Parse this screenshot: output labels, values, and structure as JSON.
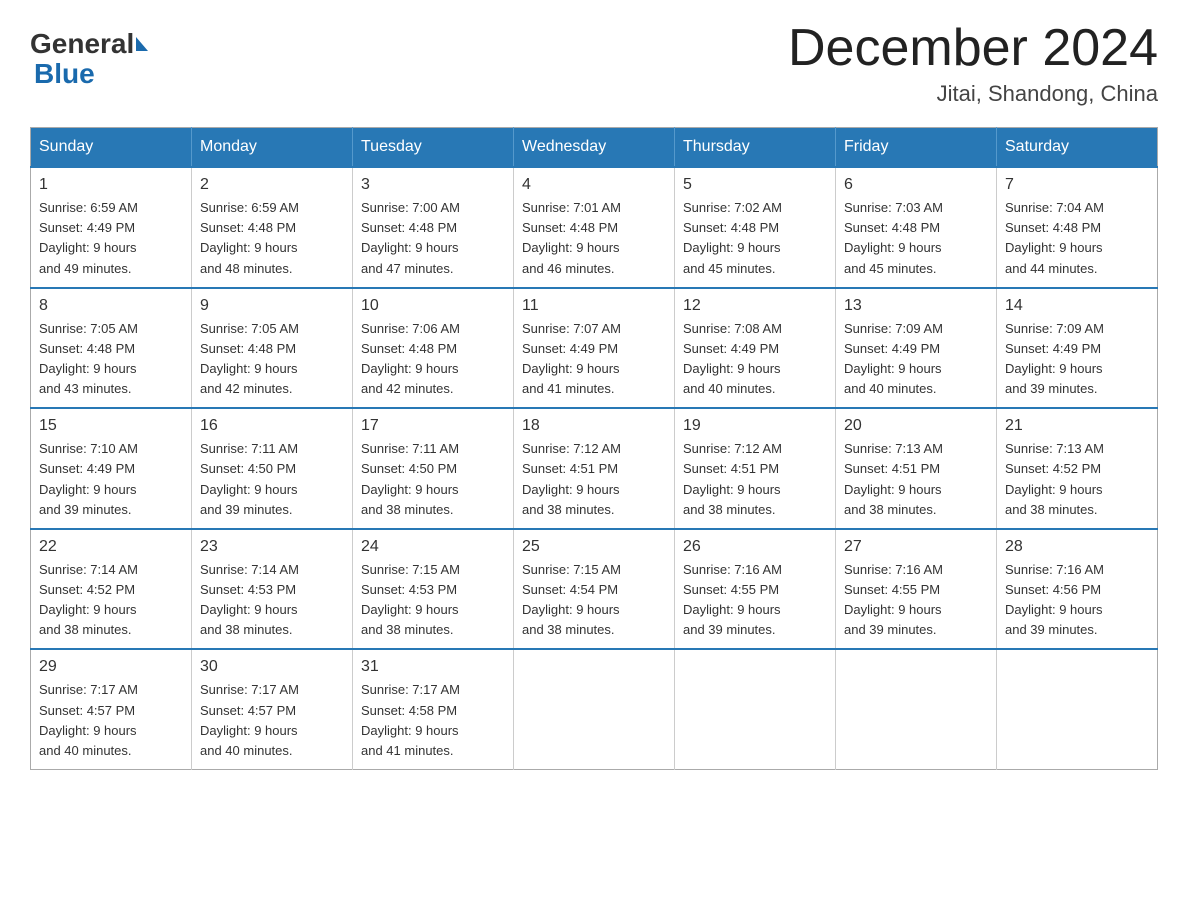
{
  "header": {
    "logo": {
      "general": "General",
      "blue": "Blue"
    },
    "title": "December 2024",
    "location": "Jitai, Shandong, China"
  },
  "days_of_week": [
    "Sunday",
    "Monday",
    "Tuesday",
    "Wednesday",
    "Thursday",
    "Friday",
    "Saturday"
  ],
  "weeks": [
    [
      {
        "day": "1",
        "sunrise": "6:59 AM",
        "sunset": "4:49 PM",
        "daylight": "9 hours and 49 minutes."
      },
      {
        "day": "2",
        "sunrise": "6:59 AM",
        "sunset": "4:48 PM",
        "daylight": "9 hours and 48 minutes."
      },
      {
        "day": "3",
        "sunrise": "7:00 AM",
        "sunset": "4:48 PM",
        "daylight": "9 hours and 47 minutes."
      },
      {
        "day": "4",
        "sunrise": "7:01 AM",
        "sunset": "4:48 PM",
        "daylight": "9 hours and 46 minutes."
      },
      {
        "day": "5",
        "sunrise": "7:02 AM",
        "sunset": "4:48 PM",
        "daylight": "9 hours and 45 minutes."
      },
      {
        "day": "6",
        "sunrise": "7:03 AM",
        "sunset": "4:48 PM",
        "daylight": "9 hours and 45 minutes."
      },
      {
        "day": "7",
        "sunrise": "7:04 AM",
        "sunset": "4:48 PM",
        "daylight": "9 hours and 44 minutes."
      }
    ],
    [
      {
        "day": "8",
        "sunrise": "7:05 AM",
        "sunset": "4:48 PM",
        "daylight": "9 hours and 43 minutes."
      },
      {
        "day": "9",
        "sunrise": "7:05 AM",
        "sunset": "4:48 PM",
        "daylight": "9 hours and 42 minutes."
      },
      {
        "day": "10",
        "sunrise": "7:06 AM",
        "sunset": "4:48 PM",
        "daylight": "9 hours and 42 minutes."
      },
      {
        "day": "11",
        "sunrise": "7:07 AM",
        "sunset": "4:49 PM",
        "daylight": "9 hours and 41 minutes."
      },
      {
        "day": "12",
        "sunrise": "7:08 AM",
        "sunset": "4:49 PM",
        "daylight": "9 hours and 40 minutes."
      },
      {
        "day": "13",
        "sunrise": "7:09 AM",
        "sunset": "4:49 PM",
        "daylight": "9 hours and 40 minutes."
      },
      {
        "day": "14",
        "sunrise": "7:09 AM",
        "sunset": "4:49 PM",
        "daylight": "9 hours and 39 minutes."
      }
    ],
    [
      {
        "day": "15",
        "sunrise": "7:10 AM",
        "sunset": "4:49 PM",
        "daylight": "9 hours and 39 minutes."
      },
      {
        "day": "16",
        "sunrise": "7:11 AM",
        "sunset": "4:50 PM",
        "daylight": "9 hours and 39 minutes."
      },
      {
        "day": "17",
        "sunrise": "7:11 AM",
        "sunset": "4:50 PM",
        "daylight": "9 hours and 38 minutes."
      },
      {
        "day": "18",
        "sunrise": "7:12 AM",
        "sunset": "4:51 PM",
        "daylight": "9 hours and 38 minutes."
      },
      {
        "day": "19",
        "sunrise": "7:12 AM",
        "sunset": "4:51 PM",
        "daylight": "9 hours and 38 minutes."
      },
      {
        "day": "20",
        "sunrise": "7:13 AM",
        "sunset": "4:51 PM",
        "daylight": "9 hours and 38 minutes."
      },
      {
        "day": "21",
        "sunrise": "7:13 AM",
        "sunset": "4:52 PM",
        "daylight": "9 hours and 38 minutes."
      }
    ],
    [
      {
        "day": "22",
        "sunrise": "7:14 AM",
        "sunset": "4:52 PM",
        "daylight": "9 hours and 38 minutes."
      },
      {
        "day": "23",
        "sunrise": "7:14 AM",
        "sunset": "4:53 PM",
        "daylight": "9 hours and 38 minutes."
      },
      {
        "day": "24",
        "sunrise": "7:15 AM",
        "sunset": "4:53 PM",
        "daylight": "9 hours and 38 minutes."
      },
      {
        "day": "25",
        "sunrise": "7:15 AM",
        "sunset": "4:54 PM",
        "daylight": "9 hours and 38 minutes."
      },
      {
        "day": "26",
        "sunrise": "7:16 AM",
        "sunset": "4:55 PM",
        "daylight": "9 hours and 39 minutes."
      },
      {
        "day": "27",
        "sunrise": "7:16 AM",
        "sunset": "4:55 PM",
        "daylight": "9 hours and 39 minutes."
      },
      {
        "day": "28",
        "sunrise": "7:16 AM",
        "sunset": "4:56 PM",
        "daylight": "9 hours and 39 minutes."
      }
    ],
    [
      {
        "day": "29",
        "sunrise": "7:17 AM",
        "sunset": "4:57 PM",
        "daylight": "9 hours and 40 minutes."
      },
      {
        "day": "30",
        "sunrise": "7:17 AM",
        "sunset": "4:57 PM",
        "daylight": "9 hours and 40 minutes."
      },
      {
        "day": "31",
        "sunrise": "7:17 AM",
        "sunset": "4:58 PM",
        "daylight": "9 hours and 41 minutes."
      },
      null,
      null,
      null,
      null
    ]
  ],
  "labels": {
    "sunrise": "Sunrise:",
    "sunset": "Sunset:",
    "daylight": "Daylight:"
  }
}
